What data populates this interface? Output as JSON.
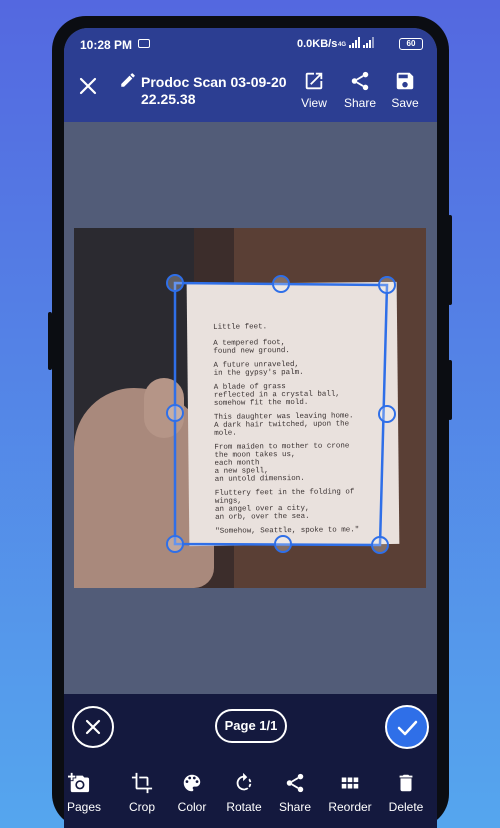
{
  "status": {
    "time": "10:28 PM",
    "speed": "0.0KB/s",
    "network": "4G",
    "battery": "60"
  },
  "header": {
    "title": "Prodoc Scan 03-09-20 22.25.38",
    "actions": [
      {
        "label": "View",
        "icon": "open-in-new-icon"
      },
      {
        "label": "Share",
        "icon": "share-icon"
      },
      {
        "label": "Save",
        "icon": "save-icon"
      }
    ]
  },
  "document": {
    "poem_title": "Little feet.",
    "stanzas": [
      [
        "A tempered foot,",
        "found new ground."
      ],
      [
        "A future unraveled,",
        "in the gypsy's palm."
      ],
      [
        "A blade of grass",
        "reflected in a crystal ball,",
        "somehow fit the mold."
      ],
      [
        "This daughter was leaving home.",
        "A dark hair twitched, upon the mole."
      ],
      [
        "From maiden to mother to crone",
        "the moon takes us,",
        "each month",
        "a new spell,",
        "an untold dimension."
      ],
      [
        "Fluttery feet in the folding of",
        "wings,",
        "an angel over a city,",
        "an orb, over the sea."
      ],
      [
        "\"Somehow, Seattle, spoke to me.\""
      ]
    ]
  },
  "controls": {
    "page_indicator": "Page 1/1"
  },
  "toolbar": [
    {
      "label": "d Pages",
      "icon": "add-photo-icon"
    },
    {
      "label": "Crop",
      "icon": "crop-icon"
    },
    {
      "label": "Color",
      "icon": "palette-icon"
    },
    {
      "label": "Rotate",
      "icon": "rotate-icon"
    },
    {
      "label": "Share",
      "icon": "share-icon"
    },
    {
      "label": "Reorder",
      "icon": "grid-icon"
    },
    {
      "label": "Delete",
      "icon": "trash-icon"
    }
  ],
  "colors": {
    "appbar": "#2c3e92",
    "accent": "#2f6fe8",
    "bottom_panel": "#14193e"
  }
}
